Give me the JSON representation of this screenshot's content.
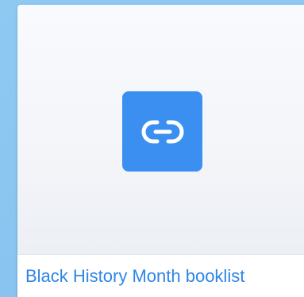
{
  "card": {
    "title": "Black History Month booklist",
    "icon": "link-icon",
    "accent_color": "#3a8ff0",
    "title_color": "#2f86e6"
  }
}
